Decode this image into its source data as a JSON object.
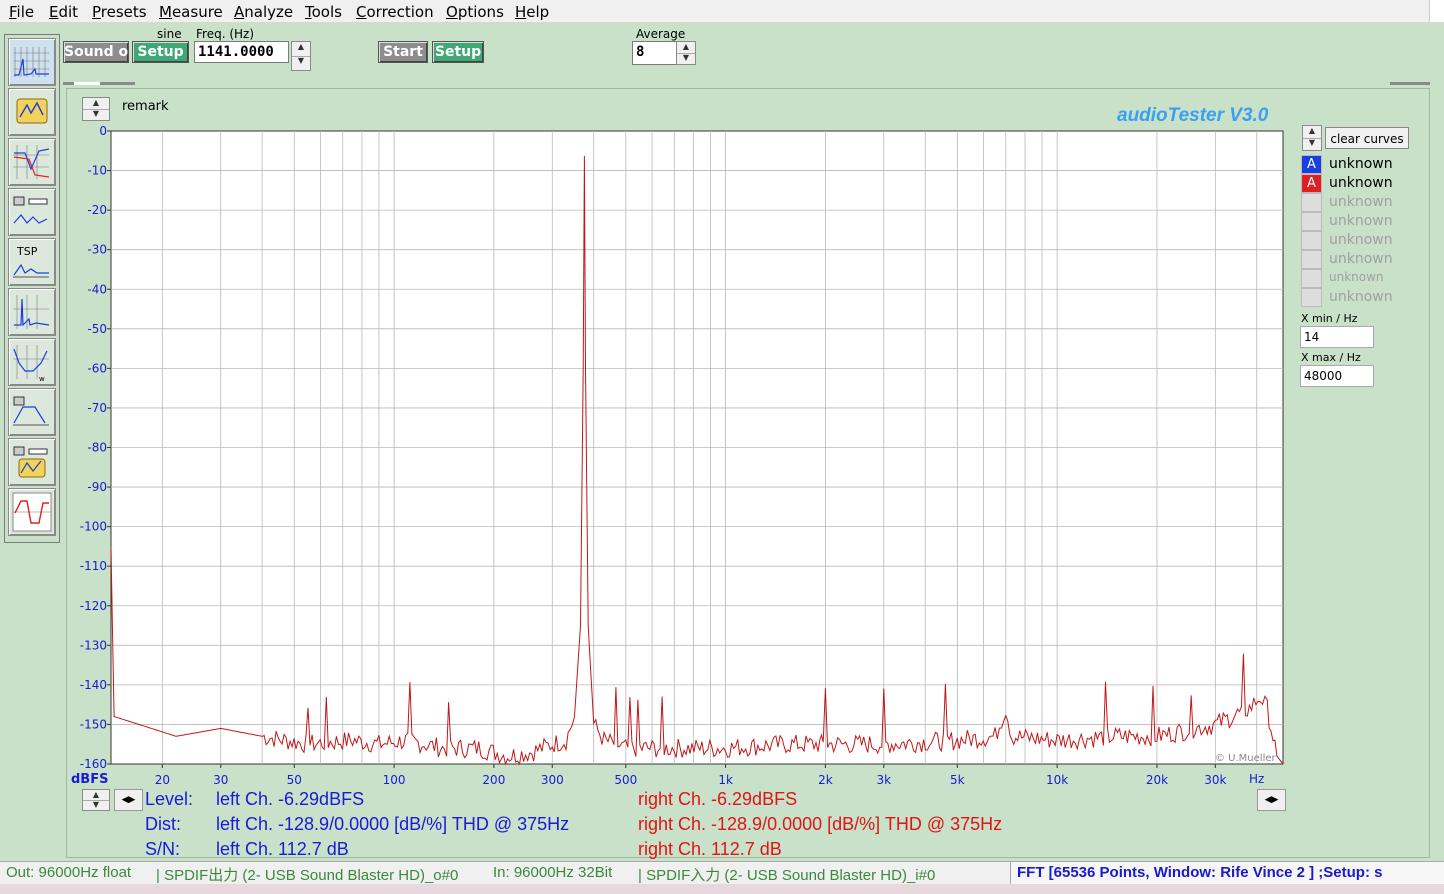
{
  "menu": [
    "File",
    "Edit",
    "Presets",
    "Measure",
    "Analyze",
    "Tools",
    "Correction",
    "Options",
    "Help"
  ],
  "toolbar": {
    "sound_button": "Sound or",
    "signal_label": "sine",
    "setup1": "Setup",
    "freq_label": "Freq. (Hz)",
    "freq_value": "1141.0000",
    "start_button": "Start",
    "setup2": "Setup",
    "average_label": "Average",
    "average_value": "8"
  },
  "chart_header": {
    "remark": "remark",
    "brand": "audioTester  V3.0",
    "watermark": "© U.Mueller"
  },
  "chart_data": {
    "type": "line",
    "x_scale": "log",
    "xlim": [
      14,
      48000
    ],
    "ylim": [
      -160,
      0
    ],
    "ylabel": "dBFS",
    "xunit": "Hz",
    "y_ticks": [
      0,
      -10,
      -20,
      -30,
      -40,
      -50,
      -60,
      -70,
      -80,
      -90,
      -100,
      -110,
      -120,
      -130,
      -140,
      -150,
      -160
    ],
    "x_ticks": [
      {
        "v": 20,
        "label": "20"
      },
      {
        "v": 30,
        "label": "30"
      },
      {
        "v": 50,
        "label": "50"
      },
      {
        "v": 100,
        "label": "100"
      },
      {
        "v": 200,
        "label": "200"
      },
      {
        "v": 300,
        "label": "300"
      },
      {
        "v": 500,
        "label": "500"
      },
      {
        "v": 1000,
        "label": "1k"
      },
      {
        "v": 2000,
        "label": "2k"
      },
      {
        "v": 3000,
        "label": "3k"
      },
      {
        "v": 5000,
        "label": "5k"
      },
      {
        "v": 10000,
        "label": "10k"
      },
      {
        "v": 20000,
        "label": "20k"
      },
      {
        "v": 30000,
        "label": "30k"
      }
    ],
    "grid": true,
    "series": [
      {
        "color": "#c01818",
        "points": [
          [
            14,
            -105
          ],
          [
            14.3,
            -148
          ],
          [
            17,
            -150
          ],
          [
            22,
            -153
          ],
          [
            30,
            -151
          ],
          [
            40,
            -153
          ],
          [
            55,
            -155
          ],
          [
            75,
            -154
          ],
          [
            90,
            -155
          ],
          [
            110,
            -154
          ],
          [
            140,
            -156
          ],
          [
            180,
            -156
          ],
          [
            220,
            -158
          ],
          [
            260,
            -157
          ],
          [
            300,
            -155
          ],
          [
            330,
            -154
          ],
          [
            350,
            -148
          ],
          [
            365,
            -125
          ],
          [
            372,
            -60
          ],
          [
            375,
            -6.3
          ],
          [
            378,
            -60
          ],
          [
            385,
            -125
          ],
          [
            400,
            -150
          ],
          [
            430,
            -154
          ],
          [
            500,
            -156
          ],
          [
            700,
            -156
          ],
          [
            1000,
            -156
          ],
          [
            1500,
            -155
          ],
          [
            1900,
            -155
          ],
          [
            1970,
            -155
          ],
          [
            2000,
            -140
          ],
          [
            2030,
            -155
          ],
          [
            3000,
            -155
          ],
          [
            5000,
            -154
          ],
          [
            6500,
            -153
          ],
          [
            7000,
            -146
          ],
          [
            7300,
            -153
          ],
          [
            10000,
            -154
          ],
          [
            15000,
            -153
          ],
          [
            20000,
            -153
          ],
          [
            30000,
            -150
          ],
          [
            38000,
            -146
          ],
          [
            41000,
            -143
          ],
          [
            43000,
            -146
          ],
          [
            46000,
            -158
          ],
          [
            48000,
            -160
          ]
        ]
      }
    ]
  },
  "legend": {
    "clear_button": "clear curves",
    "items": [
      {
        "letter": "A",
        "label": "unknown",
        "color": "#1a3ee0",
        "active": true
      },
      {
        "letter": "A",
        "label": "unknown",
        "color": "#e02020",
        "active": true
      },
      {
        "label": "unknown",
        "active": false
      },
      {
        "label": "unknown",
        "active": false
      },
      {
        "label": "unknown",
        "active": false
      },
      {
        "label": "unknown",
        "active": false
      },
      {
        "label": "unknown",
        "active": false
      },
      {
        "label": "unknown",
        "active": false
      }
    ],
    "xmin_label": "X min / Hz",
    "xmin_value": "14",
    "xmax_label": "X max / Hz",
    "xmax_value": "48000"
  },
  "results": {
    "level_label": "Level:",
    "dist_label": "Dist:",
    "sn_label": "S/N:",
    "left_level": "left Ch. -6.29dBFS",
    "left_dist": "left Ch. -128.9/0.0000 [dB/%] THD @ 375Hz",
    "left_sn": "left Ch. 112.7 dB",
    "right_level": "right Ch. -6.29dBFS",
    "right_dist": "right Ch. -128.9/0.0000 [dB/%] THD @ 375Hz",
    "right_sn": "right Ch. 112.7 dB"
  },
  "status": {
    "out": "Out: 96000Hz float",
    "out_dev": "| SPDIF出力 (2- USB Sound Blaster HD)_o#0",
    "in": "In: 96000Hz 32Bit",
    "in_dev": "| SPDIF入力 (2- USB Sound Blaster HD)_i#0",
    "fft": "FFT [65536 Points, Window: Rife Vince 2 ] ;Setup: s"
  }
}
